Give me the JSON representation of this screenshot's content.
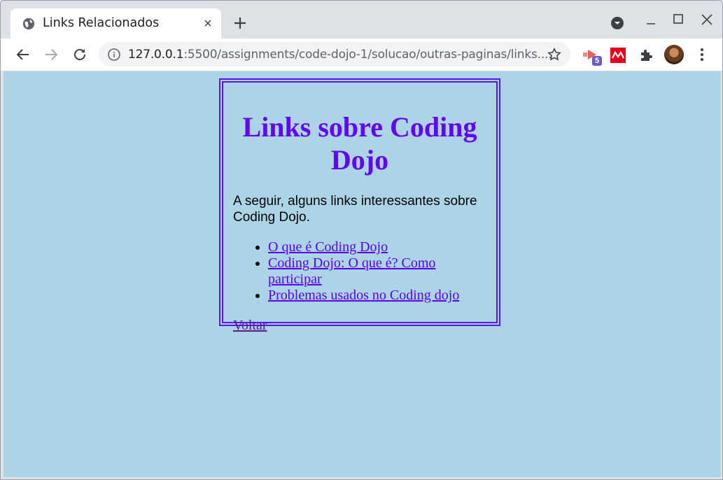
{
  "browser": {
    "tab": {
      "title": "Links Relacionados",
      "favicon": "globe-icon"
    },
    "url": {
      "host": "127.0.0.1",
      "rest": ":5500/assignments/code-dojo-1/solucao/outras-paginas/links...."
    },
    "extensions": [
      {
        "name": "extension-red-play-icon",
        "badge": "5"
      },
      {
        "name": "extension-mendeley-icon"
      },
      {
        "name": "extensions-puzzle-icon"
      }
    ]
  },
  "page": {
    "heading": "Links sobre Coding Dojo",
    "intro": "A seguir, alguns links interessantes sobre Coding Dojo.",
    "links": [
      "O que é Coding Dojo",
      "Coding Dojo: O que é? Como participar",
      "Problemas usados no Coding dojo"
    ],
    "back_link": "Voltar"
  },
  "colors": {
    "page_background": "#abd4e6",
    "heading": "#6305f0",
    "border": "#5c16f5",
    "link": "#5a00f0",
    "visited_link": "#551a8b"
  }
}
